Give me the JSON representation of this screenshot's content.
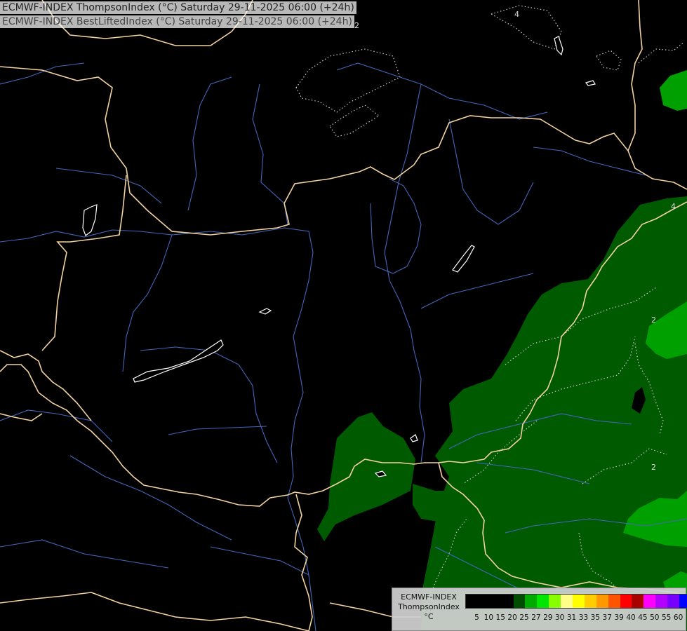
{
  "header": {
    "line1": "ECMWF-INDEX ThompsonIndex (°C) Saturday 29-11-2025 06:00 (+24h)",
    "line2": "ECMWF-INDEX BestLiftedIndex (°C) Saturday 29-11-2025 06:00 (+24h)"
  },
  "map": {
    "background": "#000000",
    "border_color": "#f2d2a0",
    "river_color": "#4a6fc0",
    "lake_color": "#ffffff",
    "contour_labels": [
      "2",
      "2",
      "4",
      "4",
      "2"
    ]
  },
  "legend": {
    "line1": "ECMWF-INDEX",
    "line2": "ThompsonIndex",
    "line3": "°C",
    "ticks": [
      "5",
      "10",
      "15",
      "20",
      "25",
      "27",
      "29",
      "30",
      "31",
      "33",
      "35",
      "37",
      "39",
      "40",
      "45",
      "50",
      "55",
      "60"
    ],
    "colors": [
      "#000000",
      "#000000",
      "#000000",
      "#000000",
      "#004d00",
      "#00aa00",
      "#00e600",
      "#88ff00",
      "#ffff88",
      "#ffff00",
      "#ffcc00",
      "#ff9900",
      "#ff5500",
      "#ff0000",
      "#aa0000",
      "#ff00ff",
      "#b400ff",
      "#7700ff",
      "#0000ff"
    ]
  }
}
